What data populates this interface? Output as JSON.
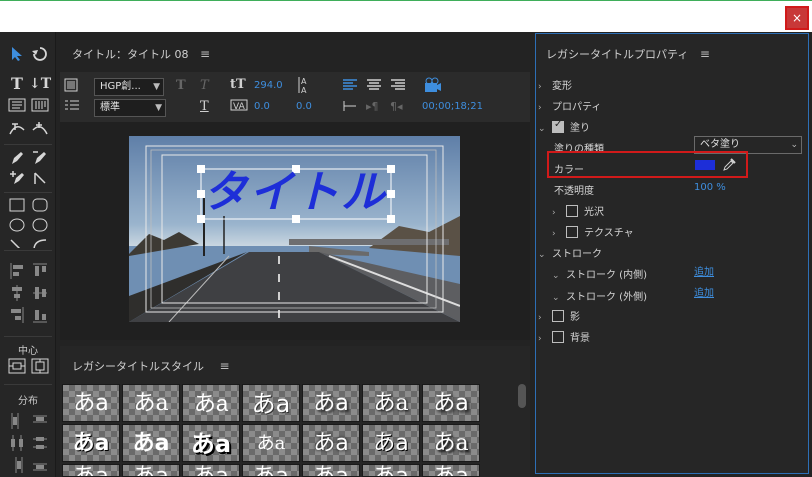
{
  "window": {
    "close_label": "×"
  },
  "tools": {
    "center_label": "中心",
    "distribute_label": "分布"
  },
  "title_panel": {
    "header": "タイトル：タイトル 08",
    "menu_icon": "≡",
    "font_family": "HGP創...",
    "font_style": "標準",
    "font_size": "294.0",
    "tracking": "0.0",
    "kerning": "0.0",
    "timecode": "00;00;18;21",
    "canvas_text": "タイトル"
  },
  "style_panel": {
    "header": "レガシータイトルスタイル",
    "swatches": [
      "あa",
      "あa",
      "あa",
      "あa",
      "あa",
      "あa",
      "あa",
      "あa",
      "あa",
      "あa",
      "あa",
      "あa",
      "あa",
      "あa",
      "あa",
      "あa",
      "あa",
      "あa",
      "あa",
      "あa",
      "あa"
    ]
  },
  "props_panel": {
    "header": "レガシータイトルプロパティ",
    "transform": "変形",
    "properties": "プロパティ",
    "fill": "塗り",
    "fill_type_label": "塗りの種類",
    "fill_type_value": "ベタ塗り",
    "color_label": "カラー",
    "opacity_label": "不透明度",
    "opacity_value": "100 %",
    "sheen": "光沢",
    "texture": "テクスチャ",
    "stroke": "ストローク",
    "stroke_inner": "ストローク (内側)",
    "stroke_outer": "ストローク (外側)",
    "add_label": "追加",
    "shadow": "影",
    "background": "背景",
    "fill_color": "#1d2ed8"
  },
  "colors": {
    "accent": "#3e8ede",
    "highlight": "#d11a1a",
    "panel_border": "#2d6fb6"
  }
}
